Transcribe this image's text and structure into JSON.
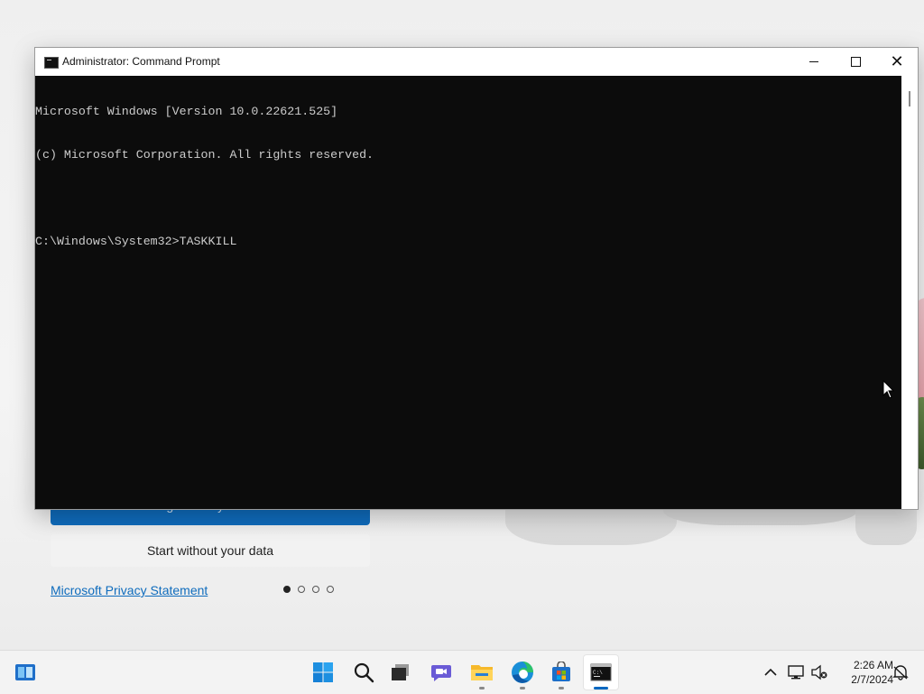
{
  "window": {
    "title": "Administrator: Command Prompt",
    "minimize_label": "Minimize",
    "maximize_label": "Maximize",
    "close_label": "Close"
  },
  "console": {
    "lines": [
      "Microsoft Windows [Version 10.0.22621.525]",
      "(c) Microsoft Corporation. All rights reserved.",
      "",
      "C:\\Windows\\System32>TASKKILL"
    ]
  },
  "background": {
    "sync_button_label": "Sign in to sync data",
    "start_button_label": "Start without your data",
    "privacy_link": "Microsoft Privacy Statement",
    "carousel": {
      "count": 4,
      "active_index": 0
    }
  },
  "taskbar": {
    "items": [
      {
        "name": "widgets",
        "icon": "widgets-icon"
      },
      {
        "name": "start",
        "icon": "windows-start-icon"
      },
      {
        "name": "search",
        "icon": "search-icon"
      },
      {
        "name": "task-view",
        "icon": "task-view-icon"
      },
      {
        "name": "chat",
        "icon": "teams-chat-icon"
      },
      {
        "name": "file-explorer",
        "icon": "folder-icon"
      },
      {
        "name": "edge",
        "icon": "edge-browser-icon"
      },
      {
        "name": "store",
        "icon": "store-icon"
      },
      {
        "name": "command-prompt",
        "icon": "command-prompt-icon"
      }
    ],
    "clock": {
      "time": "2:26 AM",
      "date": "2/7/2024"
    },
    "tray_icons": [
      "chevron-up-icon",
      "network-icon",
      "volume-muted-icon",
      "notification-icon"
    ]
  },
  "colors": {
    "console_bg": "#0c0c0c",
    "console_fg": "#cccccc",
    "accent": "#0f6cbd"
  }
}
